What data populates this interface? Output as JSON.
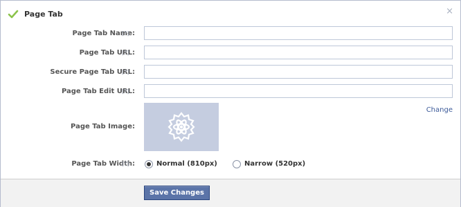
{
  "header": {
    "title": "Page Tab",
    "close_glyph": "×",
    "check_icon": "check-icon"
  },
  "help_marker": "[?]",
  "fields": [
    {
      "label": "Page Tab Name:",
      "value": "",
      "placeholder": ""
    },
    {
      "label": "Page Tab URL:",
      "value": "",
      "placeholder": ""
    },
    {
      "label": "Secure Page Tab URL:",
      "value": "",
      "placeholder": ""
    },
    {
      "label": "Page Tab Edit URL:",
      "value": "",
      "placeholder": ""
    }
  ],
  "image": {
    "label": "Page Tab Image:",
    "change_label": "Change",
    "icon": "app-gear-icon"
  },
  "width": {
    "label": "Page Tab Width:",
    "options": [
      {
        "label": "Normal (810px)",
        "selected": true
      },
      {
        "label": "Narrow (520px)",
        "selected": false
      }
    ]
  },
  "footer": {
    "save_label": "Save Changes"
  },
  "colors": {
    "accent": "#3b5998",
    "button": "#5b74a8",
    "check": "#8bc34a",
    "image_bg": "#c5cde0"
  }
}
